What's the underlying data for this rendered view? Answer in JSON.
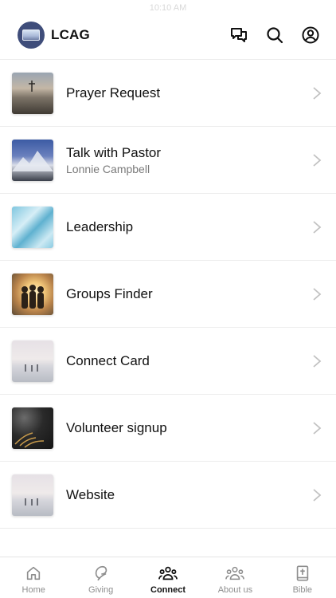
{
  "status_bar": {
    "time": "10:10 AM"
  },
  "header": {
    "app_name": "LCAG",
    "icons": [
      "chat-icon",
      "search-icon",
      "profile-icon"
    ]
  },
  "list": {
    "items": [
      {
        "title": "Prayer Request",
        "subtitle": "",
        "thumb": "mountain-cross-photo"
      },
      {
        "title": "Talk with Pastor",
        "subtitle": "Lonnie Campbell",
        "thumb": "snowy-mountain-photo"
      },
      {
        "title": "Leadership",
        "subtitle": "",
        "thumb": "blue-water-photo"
      },
      {
        "title": "Groups Finder",
        "subtitle": "",
        "thumb": "friends-sunset-photo"
      },
      {
        "title": "Connect Card",
        "subtitle": "",
        "thumb": "foggy-beach-photo"
      },
      {
        "title": "Volunteer signup",
        "subtitle": "",
        "thumb": "dark-grass-photo"
      },
      {
        "title": "Website",
        "subtitle": "",
        "thumb": "foggy-beach-photo"
      }
    ]
  },
  "tabbar": {
    "active": "Connect",
    "tabs": [
      {
        "label": "Home",
        "icon": "home-icon"
      },
      {
        "label": "Giving",
        "icon": "giving-icon"
      },
      {
        "label": "Connect",
        "icon": "connect-group-icon"
      },
      {
        "label": "About us",
        "icon": "about-group-icon"
      },
      {
        "label": "Bible",
        "icon": "bible-icon"
      }
    ]
  },
  "colors": {
    "text": "#111111",
    "muted": "#7a7a7a",
    "divider": "#ececec",
    "tab_inactive": "#8e8e8e",
    "logo_bg": "#3f4d7a"
  }
}
